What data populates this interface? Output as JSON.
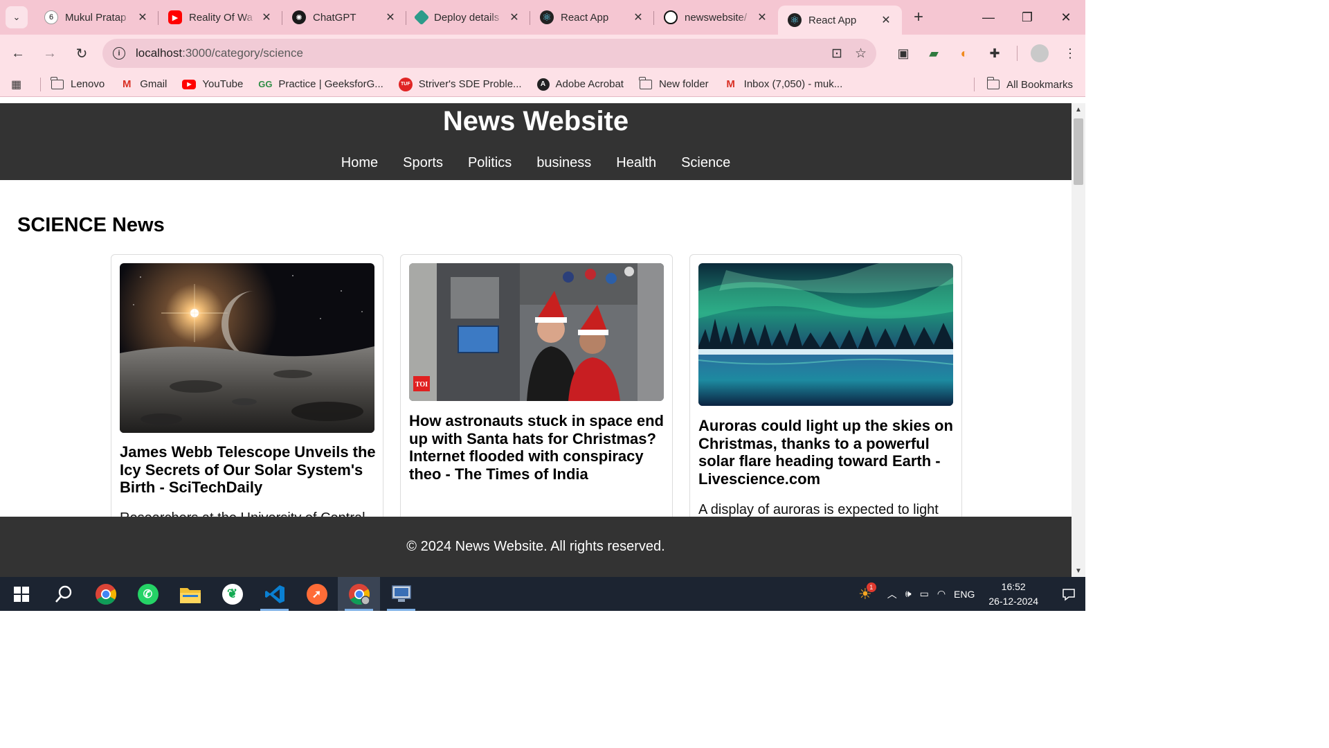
{
  "browser": {
    "tabs": [
      {
        "title": "Mukul Pratap",
        "favicon_color": "#ffffff",
        "favicon_glyph": "6"
      },
      {
        "title": "Reality Of Wa",
        "favicon_color": "#ff0000",
        "favicon_glyph": "▶"
      },
      {
        "title": "ChatGPT",
        "favicon_color": "#1a1a1a",
        "favicon_glyph": "✺"
      },
      {
        "title": "Deploy details",
        "favicon_color": "#2c9b8a",
        "favicon_glyph": "◆"
      },
      {
        "title": "React App",
        "favicon_color": "#1a1a1a",
        "favicon_glyph": "⚛"
      },
      {
        "title": "newswebsite/",
        "favicon_color": "#1a1a1a",
        "favicon_glyph": "●"
      },
      {
        "title": "React App",
        "favicon_color": "#1a1a1a",
        "favicon_glyph": "⚛"
      }
    ],
    "url_host": "localhost",
    "url_path": ":3000/category/science",
    "bookmarks": [
      {
        "label": "Lenovo",
        "icon": "folder-icon"
      },
      {
        "label": "Gmail",
        "icon": "gmail-icon"
      },
      {
        "label": "YouTube",
        "icon": "youtube-icon"
      },
      {
        "label": "Practice | GeeksforG...",
        "icon": "geeksforgeeks-icon"
      },
      {
        "label": "Striver's SDE  Proble...",
        "icon": "tuf-icon"
      },
      {
        "label": "Adobe Acrobat",
        "icon": "acrobat-icon"
      },
      {
        "label": "New folder",
        "icon": "folder-icon"
      },
      {
        "label": "Inbox (7,050) - muk...",
        "icon": "gmail-icon"
      }
    ],
    "all_bookmarks": "All Bookmarks"
  },
  "site": {
    "title": "News Website",
    "nav": [
      "Home",
      "Sports",
      "Politics",
      "business",
      "Health",
      "Science"
    ],
    "heading": "SCIENCE News",
    "articles": [
      {
        "title": "James Webb Telescope Unveils the Icy Secrets of Our Solar System's Birth - SciTechDaily",
        "description": "Researchers at the University of Central",
        "image": "moon-landscape-image"
      },
      {
        "title": "How astronauts stuck in space end up with Santa hats for Christmas? Internet flooded with conspiracy theo - The Times of India",
        "description": "",
        "image": "astronauts-santa-hats-image",
        "image_badge": "TOI"
      },
      {
        "title": "Auroras could light up the skies on Christmas, thanks to a powerful solar flare heading toward Earth - Livescience.com",
        "description": "A display of auroras is expected to light up",
        "image": "aurora-forest-image"
      }
    ],
    "footer": "© 2024 News Website. All rights reserved."
  },
  "taskbar": {
    "apps": [
      "start-icon",
      "search-icon",
      "chrome-icon",
      "whatsapp-icon",
      "file-explorer-icon",
      "mongodb-compass-icon",
      "vscode-icon",
      "postman-icon",
      "chrome-profile-icon",
      "remote-desktop-icon"
    ],
    "weather_badge": "1",
    "language": "ENG",
    "time": "16:52",
    "date": "26-12-2024"
  }
}
